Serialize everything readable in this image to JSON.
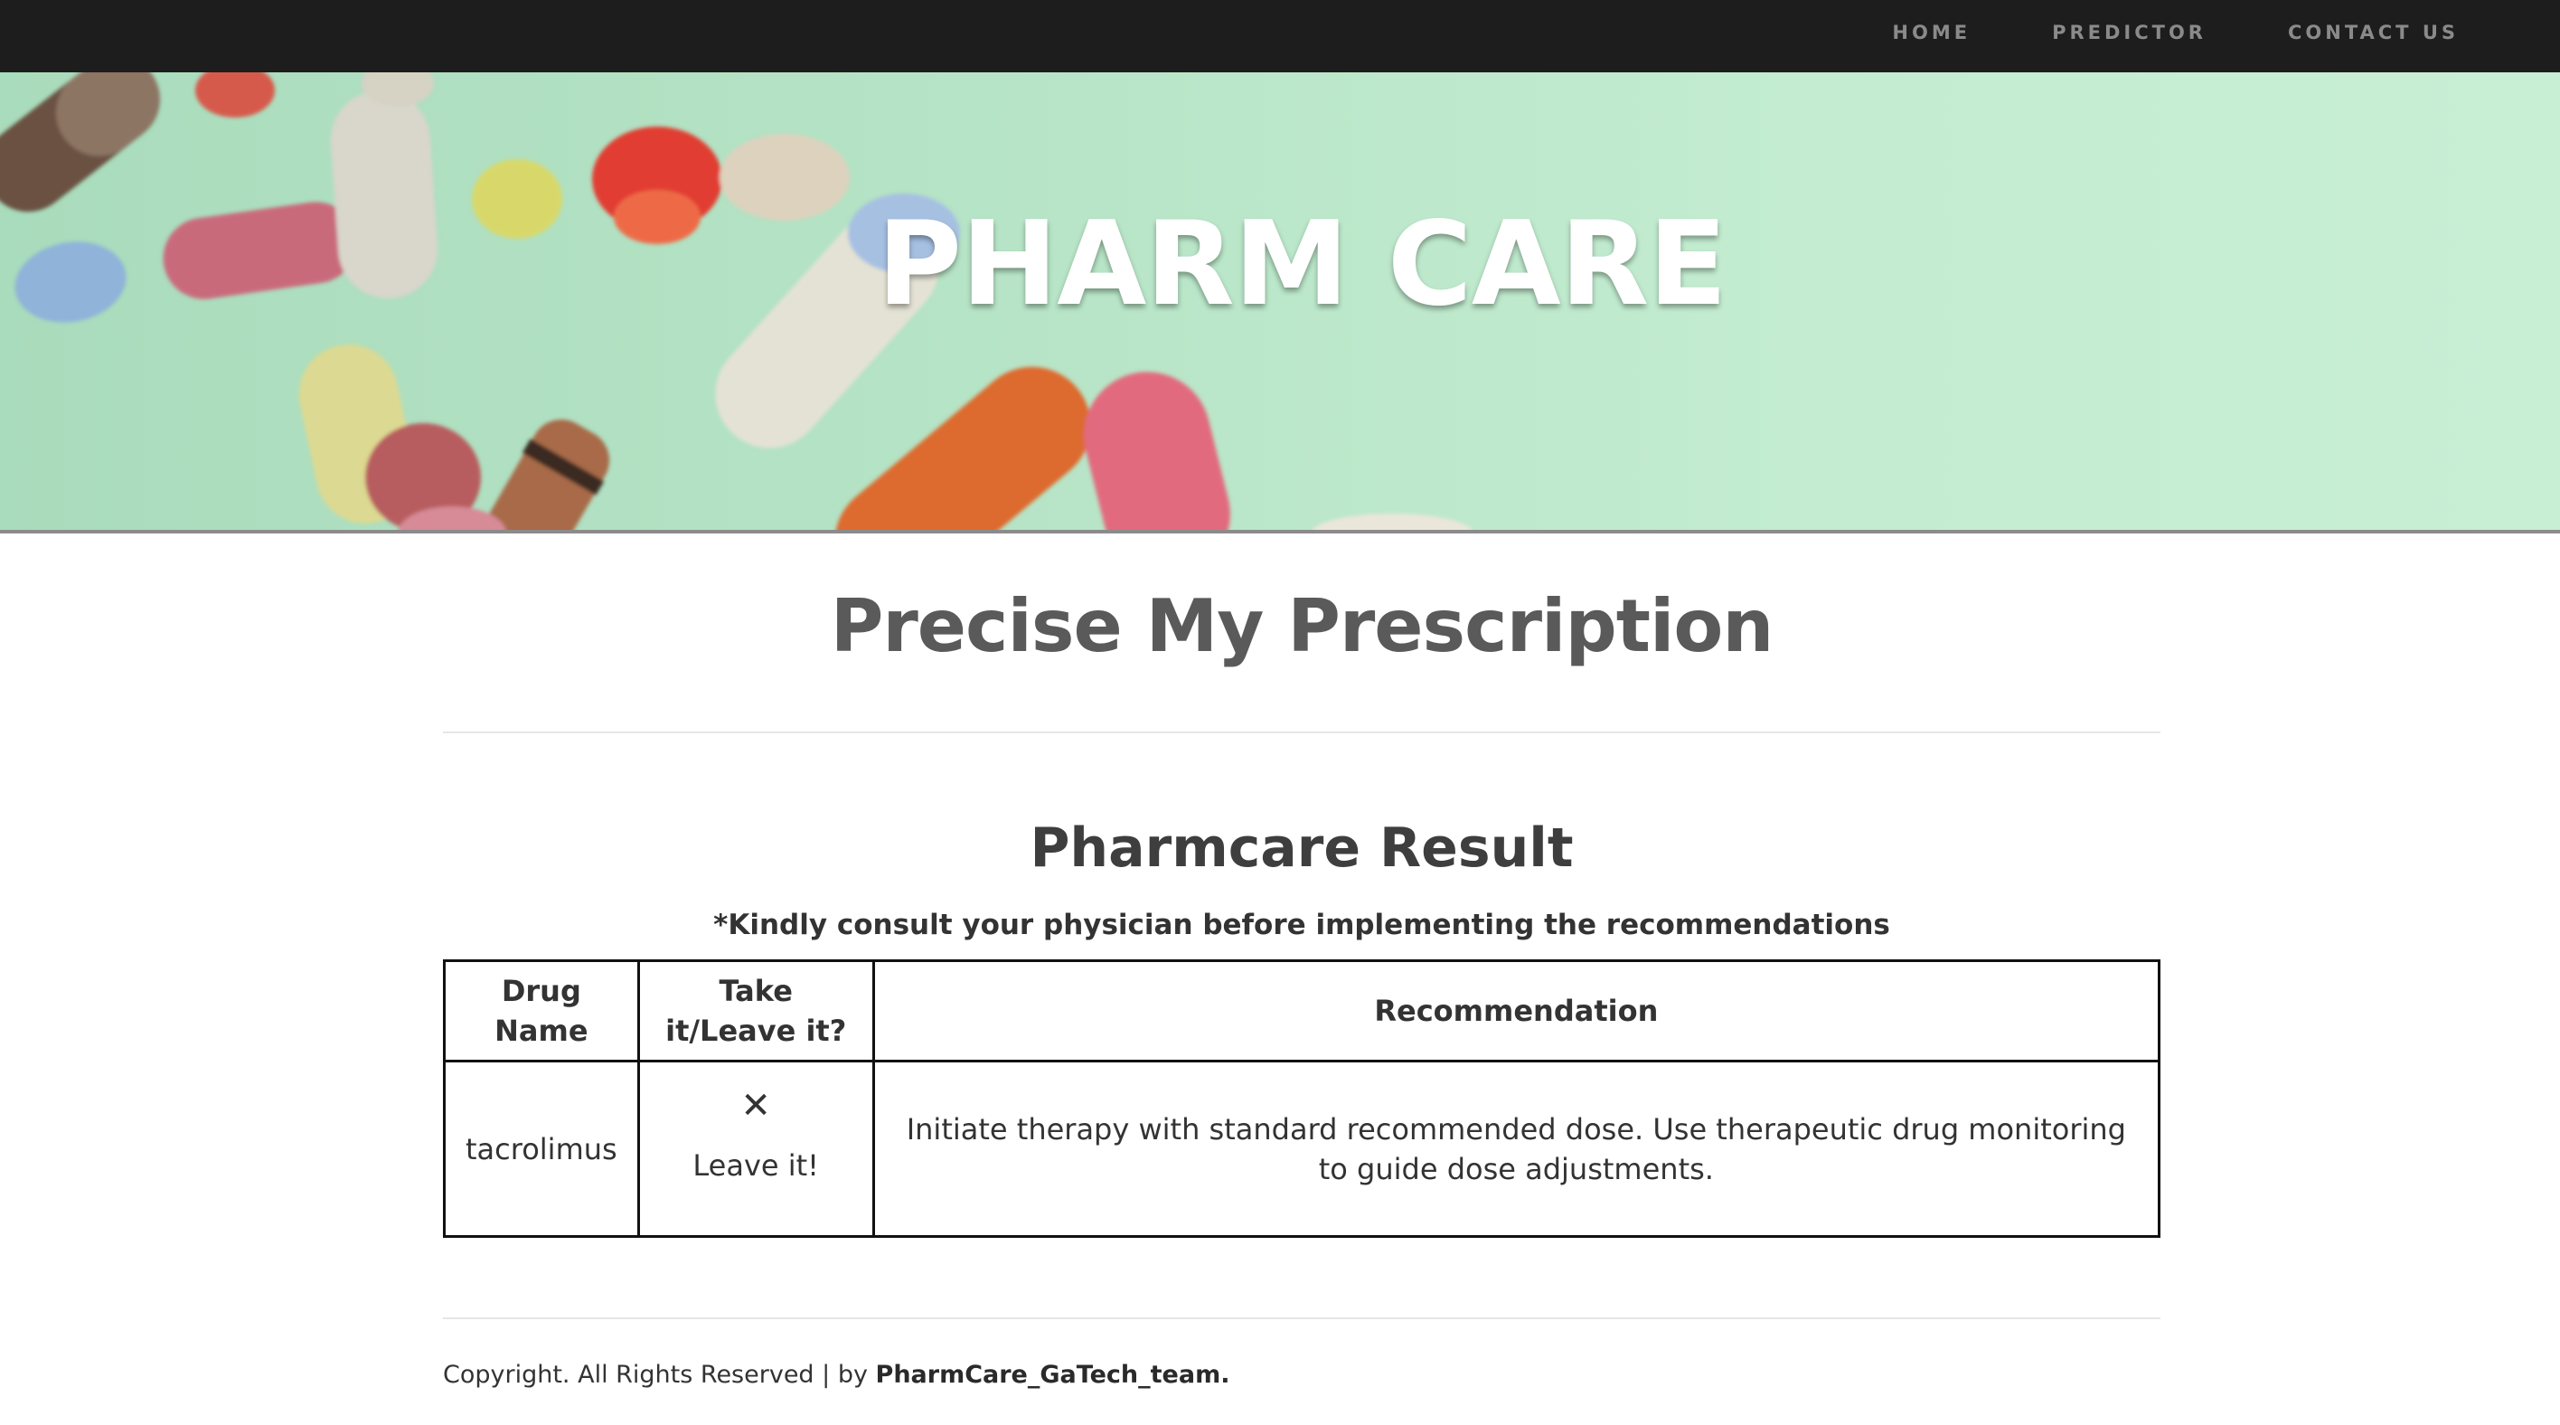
{
  "nav": {
    "items": [
      {
        "label": "HOME"
      },
      {
        "label": "PREDICTOR"
      },
      {
        "label": "CONTACT US"
      }
    ]
  },
  "hero": {
    "title": "PHARM CARE"
  },
  "main": {
    "page_title": "Precise My Prescription",
    "result_title": "Pharmcare Result",
    "disclaimer": "*Kindly consult your physician before implementing the recommendations",
    "table": {
      "headers": [
        "Drug Name",
        "Take it/Leave it?",
        "Recommendation"
      ],
      "rows": [
        {
          "drug": "tacrolimus",
          "take_icon": "✕",
          "take": "Leave it!",
          "recommendation": "Initiate therapy with standard recommended dose. Use therapeutic drug monitoring to guide dose adjustments."
        }
      ]
    }
  },
  "footer": {
    "text": "Copyright. All Rights Reserved | by ",
    "team": "PharmCare_GaTech_team."
  },
  "colors": {
    "navbar_bg": "#1d1d1d",
    "nav_text": "#8a8a8a",
    "hero_bg": "#b5e3c5"
  }
}
